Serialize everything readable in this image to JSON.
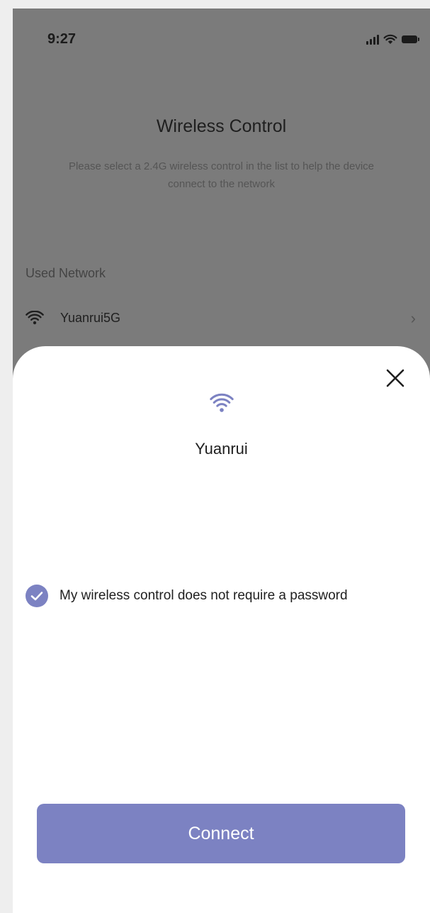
{
  "status_bar": {
    "time": "9:27"
  },
  "page": {
    "title": "Wireless Control",
    "subtitle": "Please select a 2.4G wireless control in the list to help the device connect to the network",
    "used_network_label": "Used  Network",
    "used_networks": [
      {
        "name": "Yuanrui5G"
      }
    ]
  },
  "sheet": {
    "network_name": "Yuanrui",
    "no_password_label": "My wireless control does not require a password",
    "no_password_checked": true,
    "connect_label": "Connect"
  },
  "icons": {
    "close": "close-icon",
    "wifi": "wifi-icon",
    "check": "check-icon",
    "chevron": "chevron-right-icon",
    "signal": "signal-icon",
    "battery": "battery-icon"
  },
  "colors": {
    "accent": "#7c82c2",
    "overlay": "#7b7b7b",
    "sheet": "#ffffff"
  }
}
